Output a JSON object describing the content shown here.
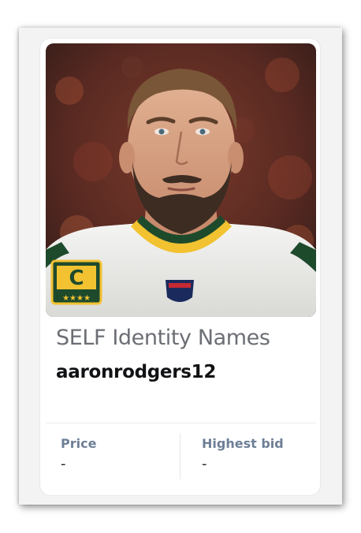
{
  "card": {
    "collection_name": "SELF Identity Names",
    "username": "aaronrodgers12",
    "price_label": "Price",
    "price_value": "-",
    "highest_bid_label": "Highest bid",
    "highest_bid_value": "-"
  },
  "image": {
    "description_icon": "profile-photo",
    "jersey_patch_letter": "C"
  },
  "colors": {
    "collection_text": "#6b6e74",
    "username_text": "#111214",
    "stat_label": "#6e7f96",
    "jersey_green": "#1e4a2c",
    "jersey_gold": "#f2c230"
  }
}
